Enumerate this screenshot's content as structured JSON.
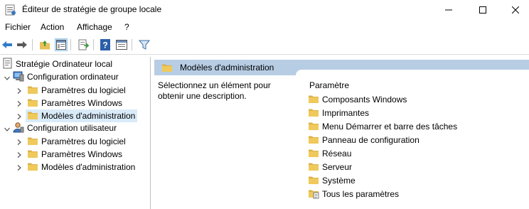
{
  "window": {
    "title": "Éditeur de stratégie de groupe locale"
  },
  "menu": [
    "Fichier",
    "Action",
    "Affichage",
    "?"
  ],
  "toolbar": {
    "icons": [
      "back-arrow-icon",
      "forward-arrow-icon",
      "folder-up-icon",
      "show-hide-tree-icon",
      "export-list-icon",
      "help-icon",
      "properties-icon",
      "filter-icon"
    ]
  },
  "tree": {
    "root": "Stratégie Ordinateur local",
    "computer_config": {
      "label": "Configuration ordinateur",
      "children": [
        "Paramètres du logiciel",
        "Paramètres Windows",
        "Modèles d'administration"
      ]
    },
    "user_config": {
      "label": "Configuration utilisateur",
      "children": [
        "Paramètres du logiciel",
        "Paramètres Windows",
        "Modèles d'administration"
      ]
    }
  },
  "details": {
    "header": "Modèles d'administration",
    "description": "Sélectionnez un élément pour obtenir une description.",
    "column_header": "Paramètre",
    "items": [
      "Composants Windows",
      "Imprimantes",
      "Menu Démarrer et barre des tâches",
      "Panneau de configuration",
      "Réseau",
      "Serveur",
      "Système",
      "Tous les paramètres"
    ]
  },
  "colors": {
    "header_bg": "#b7cde4",
    "selection_bg": "#d9ebf9",
    "folder_yellow": "#e8c15a"
  }
}
